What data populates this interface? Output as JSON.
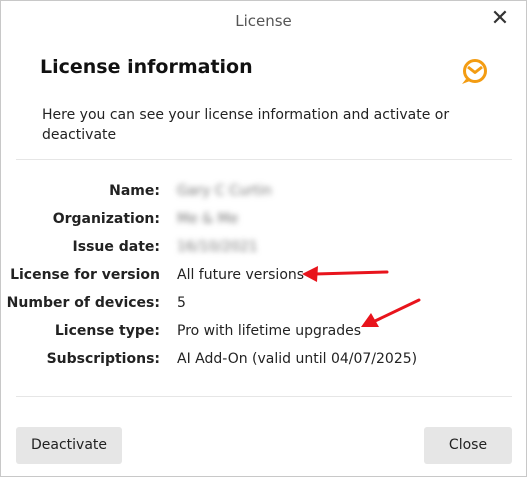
{
  "window": {
    "title": "License"
  },
  "header": {
    "heading": "License information",
    "description": "Here you can see your license information and activate or deactivate"
  },
  "fields": [
    {
      "label": "Name:",
      "value": "Gary C Curtin",
      "blurred": true
    },
    {
      "label": "Organization:",
      "value": "Me & Me",
      "blurred": true
    },
    {
      "label": "Issue date:",
      "value": "16/10/2021",
      "blurred": true
    },
    {
      "label": "License for version",
      "value": "All future versions",
      "blurred": false
    },
    {
      "label": "Number of devices:",
      "value": "5",
      "blurred": false
    },
    {
      "label": "License type:",
      "value": "Pro with lifetime upgrades",
      "blurred": false
    },
    {
      "label": "Subscriptions:",
      "value": "AI Add-On (valid until 04/07/2025)",
      "blurred": false
    }
  ],
  "buttons": {
    "deactivate": "Deactivate",
    "close": "Close"
  },
  "icons": {
    "close": "close-icon",
    "logo": "emclient-logo-icon",
    "annotation": "red-arrow-icon"
  },
  "colors": {
    "accent": "#f39c12",
    "annotation": "#e8141c",
    "button_bg": "#e6e6e6"
  }
}
